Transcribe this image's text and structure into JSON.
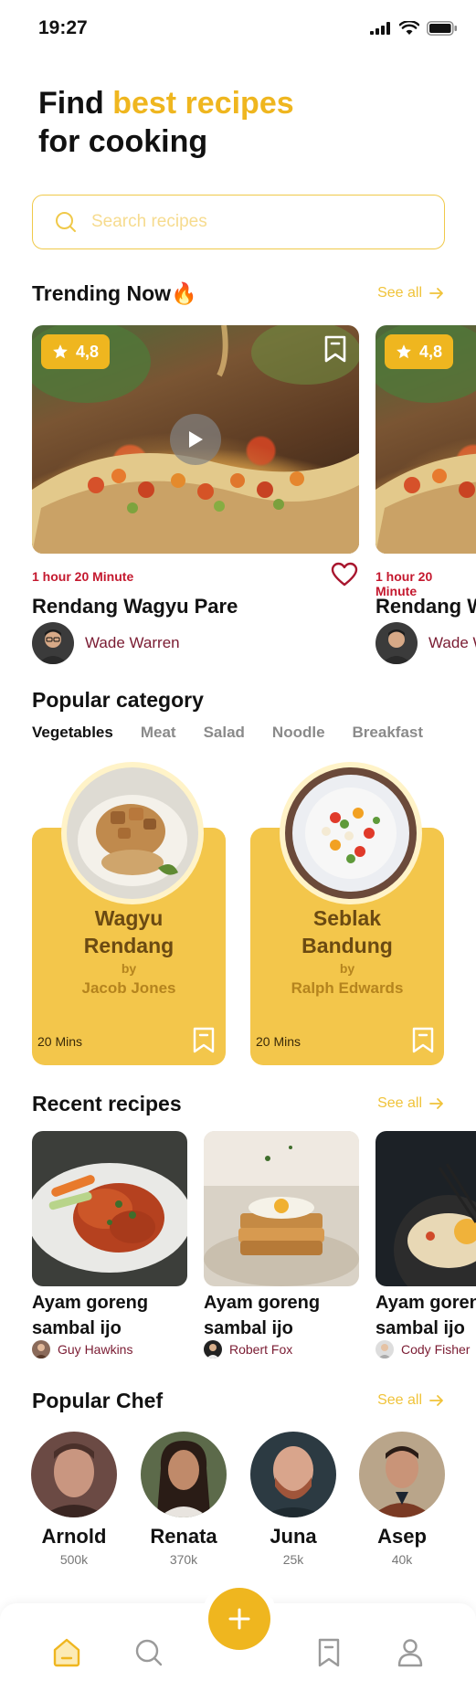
{
  "status_bar": {
    "time": "19:27"
  },
  "header": {
    "title_start": "Find ",
    "title_accent": "best recipes",
    "title_end": "for cooking"
  },
  "search": {
    "placeholder": "Search recipes"
  },
  "trending": {
    "title": "Trending Now🔥",
    "see_all": "See all",
    "cards": [
      {
        "rating": "4,8",
        "time": "1 hour 20 Minute",
        "title": "Rendang Wagyu Pare",
        "author": "Wade Warren"
      },
      {
        "rating": "4,8",
        "time": "1 hour 20 Minute",
        "title": "Rendang Wagyu Pare",
        "author": "Wade Warren"
      }
    ]
  },
  "category": {
    "title": "Popular category",
    "tabs": [
      "Vegetables",
      "Meat",
      "Salad",
      "Noodle",
      "Breakfast"
    ],
    "active_tab": "Vegetables",
    "cards": [
      {
        "name_line1": "Wagyu",
        "name_line2": "Rendang",
        "by": "by",
        "chef": "Jacob Jones",
        "time": "20 Mins"
      },
      {
        "name_line1": "Seblak",
        "name_line2": "Bandung",
        "by": "by",
        "chef": "Ralph Edwards",
        "time": "20 Mins"
      }
    ]
  },
  "recent": {
    "title": "Recent recipes",
    "see_all": "See all",
    "items": [
      {
        "title_line1": "Ayam goreng",
        "title_line2": "sambal ijo",
        "author": "Guy Hawkins"
      },
      {
        "title_line1": "Ayam goreng",
        "title_line2": "sambal ijo",
        "author": "Robert Fox"
      },
      {
        "title_line1": "Ayam goreng",
        "title_line2": "sambal ijo",
        "author": "Cody Fisher"
      }
    ]
  },
  "chefs": {
    "title": "Popular Chef",
    "see_all": "See all",
    "items": [
      {
        "name": "Arnold",
        "followers": "500k"
      },
      {
        "name": "Renata",
        "followers": "370k"
      },
      {
        "name": "Juna",
        "followers": "25k"
      },
      {
        "name": "Asep",
        "followers": "40k"
      }
    ]
  },
  "colors": {
    "accent": "#EFB61F",
    "card": "#F3C64B",
    "red": "#C4182E",
    "maroon": "#7A1B32"
  },
  "icons": {
    "nav": [
      "home-icon",
      "search-icon",
      "add-icon",
      "bookmark-icon",
      "profile-icon"
    ]
  }
}
